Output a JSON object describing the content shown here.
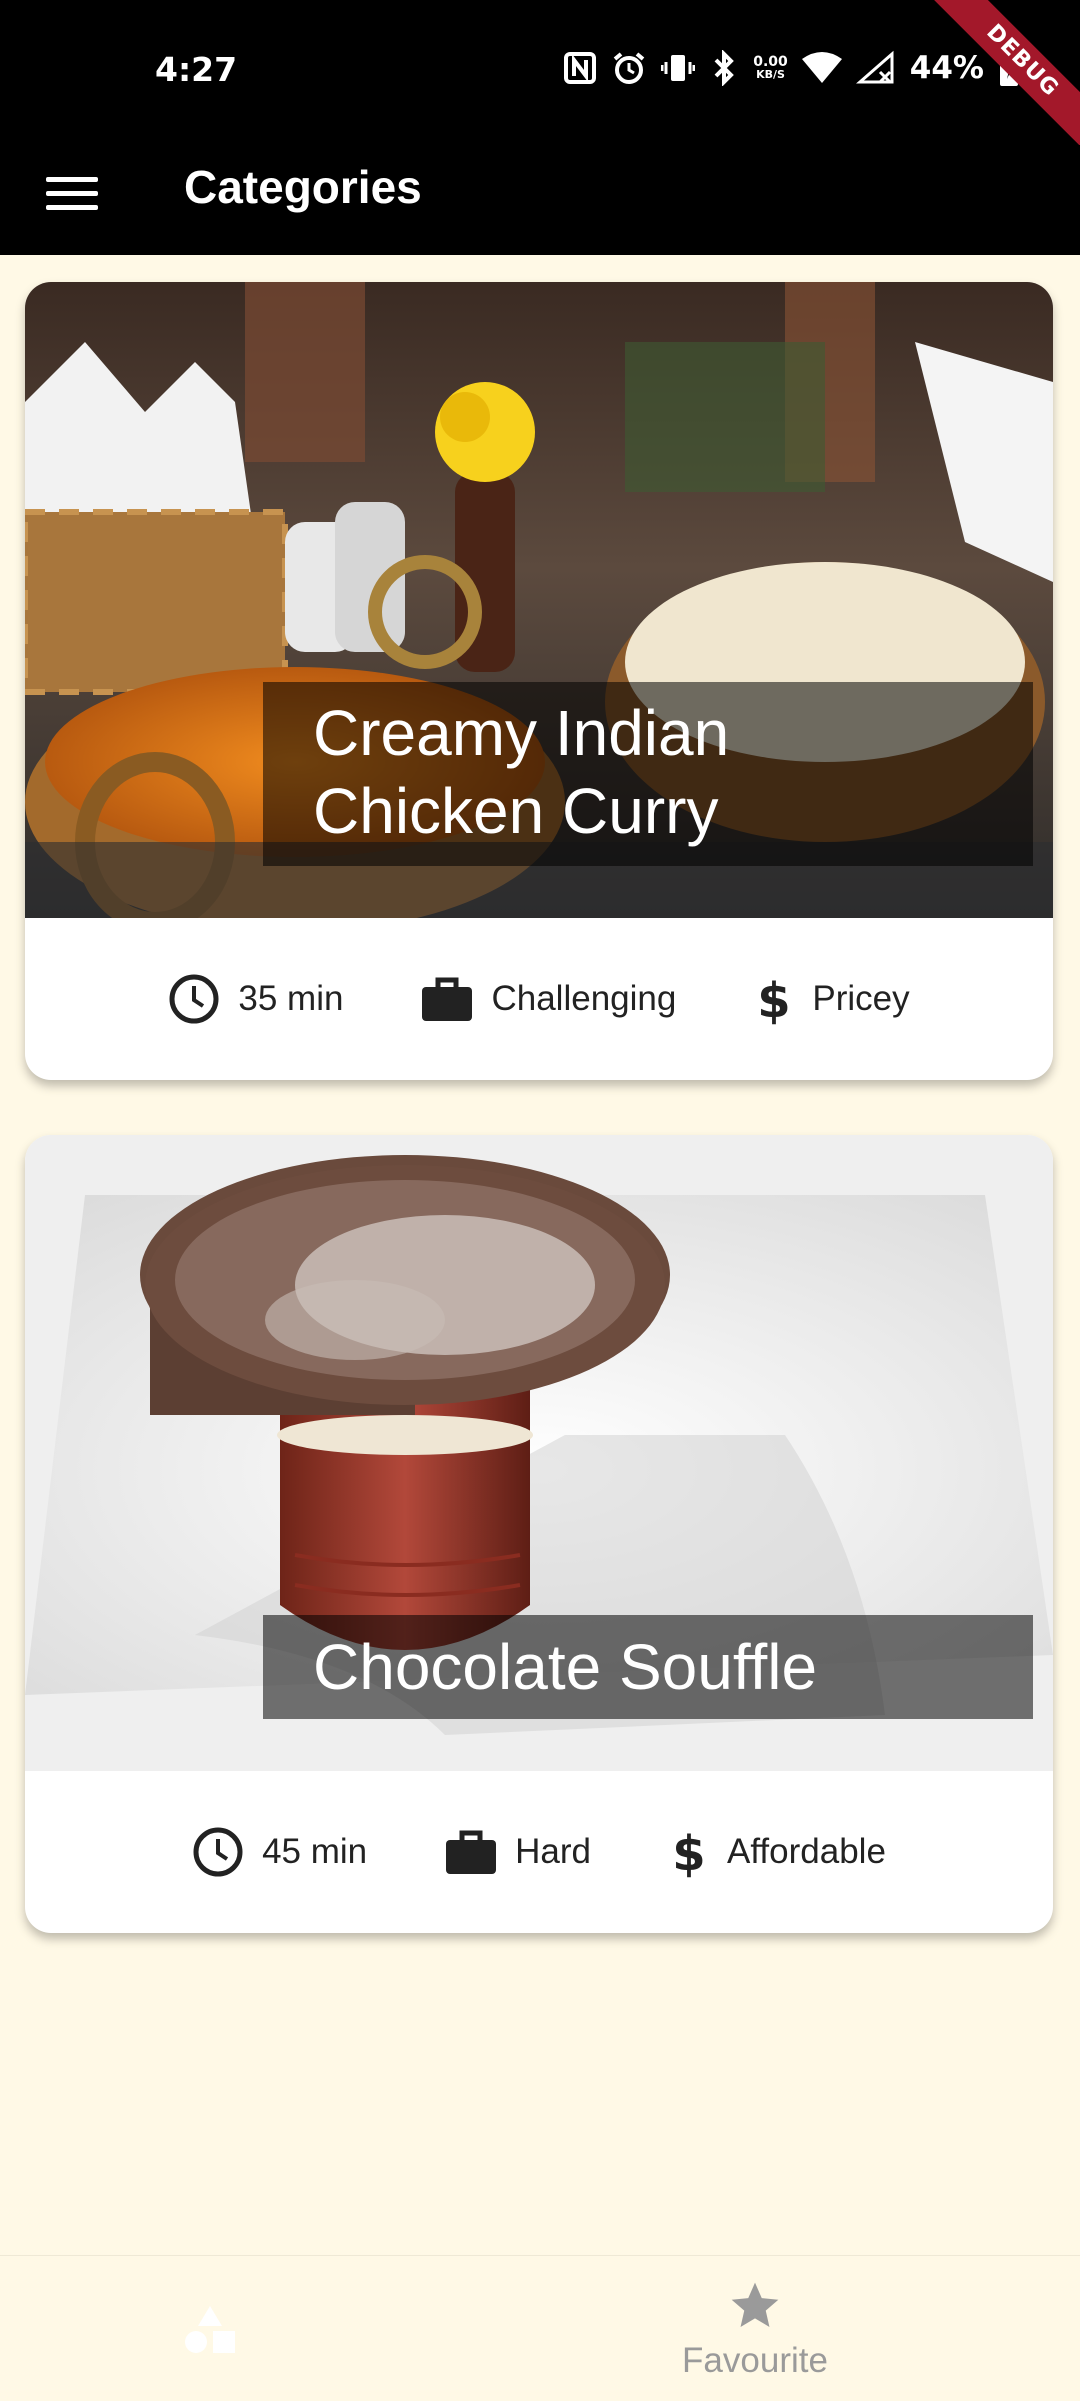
{
  "status_bar": {
    "time": "4:27",
    "speed_value": "0.00",
    "speed_unit": "KB/S",
    "battery": "44%",
    "debug_label": "DEBUG",
    "icons": [
      "nfc-icon",
      "alarm-icon",
      "vibrate-icon",
      "bluetooth-icon",
      "wifi-icon",
      "no-signal-icon",
      "battery-charging-icon"
    ]
  },
  "app_bar": {
    "title": "Categories",
    "menu_icon": "menu-icon"
  },
  "meals": [
    {
      "title": "Creamy Indian\nChicken Curry",
      "duration": "35 min",
      "complexity": "Challenging",
      "affordability": "Pricey"
    },
    {
      "title": "Chocolate Souffle",
      "duration": "45 min",
      "complexity": "Hard",
      "affordability": "Affordable"
    }
  ],
  "bottom_nav": {
    "categories_icon": "categories-icon",
    "favourite_icon": "star-icon",
    "favourite_label": "Favourite"
  },
  "colors": {
    "background": "#fff9e6",
    "app_bar": "#000000",
    "card": "#ffffff",
    "title_overlay": "rgba(0,0,0,0.54)",
    "inactive_nav": "#9a9a9a",
    "debug_ribbon": "#a3182a"
  }
}
